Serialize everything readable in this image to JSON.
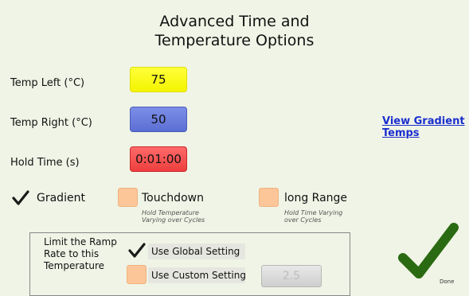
{
  "header": {
    "title_line1": "Advanced Time and",
    "title_line2": "Temperature Options"
  },
  "fields": [
    {
      "label": "Temp Left (°C)",
      "value": "75"
    },
    {
      "label": "Temp Right (°C)",
      "value": "50"
    },
    {
      "label": "Hold Time (s)",
      "value": "0:01:00"
    }
  ],
  "gradient_link": {
    "line1": "View Gradient",
    "line2": "Temps"
  },
  "options": {
    "gradient": {
      "label": "Gradient",
      "checked": true
    },
    "touchdown": {
      "label": "Touchdown",
      "sub1": "Hold Temperature",
      "sub2": "Varying over Cycles",
      "checked": false
    },
    "long_range": {
      "label": "long Range",
      "sub1": "Hold Time Varying",
      "sub2": "over Cycles",
      "checked": false
    }
  },
  "ramp": {
    "label_line1": "Limit the Ramp",
    "label_line2": "Rate to this",
    "label_line3": "Temperature",
    "global_label": "Use Global Setting",
    "custom_label": "Use Custom Setting",
    "custom_value": "2.5"
  },
  "done": {
    "label": "Done"
  },
  "colors": {
    "checkmark": "#2a6a12",
    "link": "#1b2fcf",
    "checkbox": "#fcc699"
  }
}
